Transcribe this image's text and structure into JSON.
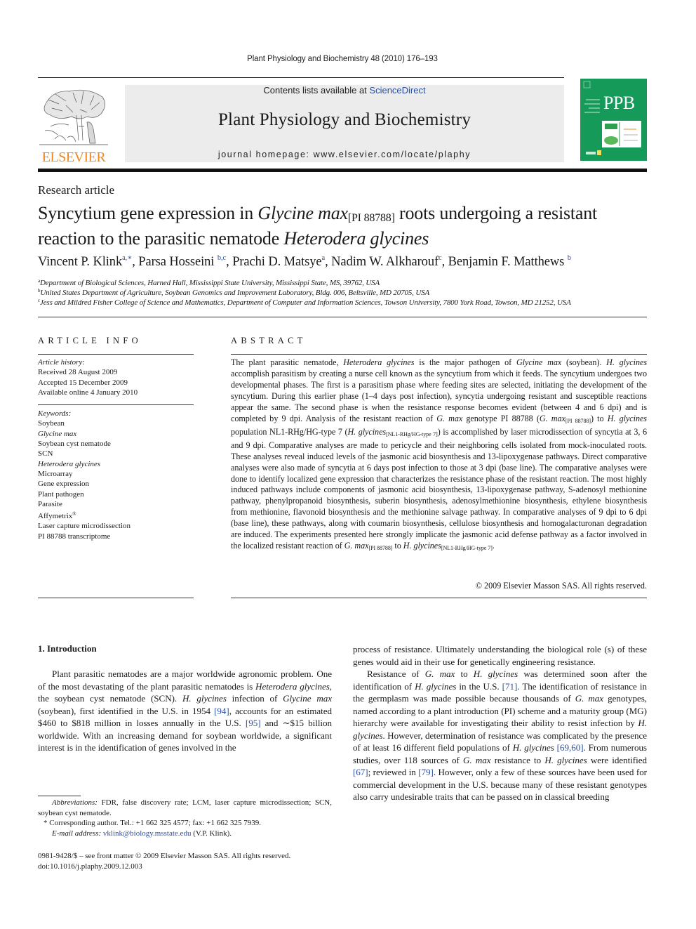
{
  "running_head": "Plant Physiology and Biochemistry 48 (2010) 176–193",
  "header": {
    "publisher_name": "ELSEVIER",
    "contents_prefix": "Contents lists available at ",
    "contents_link": "ScienceDirect",
    "journal_title": "Plant Physiology and Biochemistry",
    "homepage": "journal homepage: www.elsevier.com/locate/plaphy",
    "cover_abbrev": "PPB",
    "colors": {
      "publisher_orange": "#f0871e",
      "cover_green": "#159a5a",
      "link_blue": "#2a4fa0",
      "header_gray": "#ececec"
    }
  },
  "article": {
    "type": "Research article",
    "title": {
      "p1": "Syncytium gene expression in ",
      "p2_it": "Glycine max",
      "p3_sub": "[PI 88788]",
      "p4": " roots undergoing a resistant reaction to the parasitic nematode ",
      "p5_it": "Heterodera glycines"
    },
    "authors": [
      {
        "name": "Vincent P. Klink",
        "sup": "a,∗"
      },
      {
        "name": "Parsa Hosseini",
        "sup": "b,c"
      },
      {
        "name": "Prachi D. Matsye",
        "sup": "a"
      },
      {
        "name": "Nadim W. Alkharouf",
        "sup": "c"
      },
      {
        "name": "Benjamin F. Matthews",
        "sup": "b"
      }
    ],
    "affiliations": [
      {
        "mark": "a",
        "text": "Department of Biological Sciences, Harned Hall, Mississippi State University, Mississippi State, MS, 39762, USA"
      },
      {
        "mark": "b",
        "text": "United States Department of Agriculture, Soybean Genomics and Improvement Laboratory, Bldg. 006, Beltsville, MD 20705, USA"
      },
      {
        "mark": "c",
        "text": "Jess and Mildred Fisher College of Science and Mathematics, Department of Computer and Information Sciences, Towson University, 7800 York Road, Towson, MD 21252, USA"
      }
    ]
  },
  "article_info": {
    "heading": "ARTICLE INFO",
    "history_label": "Article history:",
    "received": "Received 28 August 2009",
    "accepted": "Accepted 15 December 2009",
    "online": "Available online 4 January 2010",
    "keywords_label": "Keywords:",
    "keywords": [
      "Soybean",
      "Glycine max",
      "Soybean cyst nematode",
      "SCN",
      "Heterodera glycines",
      "Microarray",
      "Gene expression",
      "Plant pathogen",
      "Parasite",
      "Affymetrix",
      "Laser capture microdissection",
      "PI 88788 transcriptome"
    ],
    "keyword_trademark": "®"
  },
  "abstract": {
    "heading": "ABSTRACT",
    "t01": "The plant parasitic nematode, ",
    "t02": "Heterodera glycines",
    "t03": " is the major pathogen of ",
    "t04": "Glycine max",
    "t05": " (soybean). ",
    "t06": "H. glycines",
    "t07": " accomplish parasitism by creating a nurse cell known as the syncytium from which it feeds. The syncytium undergoes two developmental phases. The first is a parasitism phase where feeding sites are selected, initiating the development of the syncytium. During this earlier phase (1–4 days post infection), syncytia undergoing resistant and susceptible reactions appear the same. The second phase is when the resistance response becomes evident (between 4 and 6 dpi) and is completed by 9 dpi. Analysis of the resistant reaction of ",
    "t08": "G. max",
    "t09": " genotype PI 88788 (",
    "t10": "G. max",
    "t11": "[PI 88788]",
    "t12": ") to ",
    "t13": "H. glycines",
    "t14": " population NL1-RHg/HG-type 7 (",
    "t15": "H. glycines",
    "t16": "[NL1-RHg/HG-type 7]",
    "t17": ") is accomplished by laser microdissection of syncytia at 3, 6 and 9 dpi. Comparative analyses are made to pericycle and their neighboring cells isolated from mock-inoculated roots. These analyses reveal induced levels of the jasmonic acid biosynthesis and 13-lipoxygenase pathways. Direct comparative analyses were also made of syncytia at 6 days post infection to those at 3 dpi (base line). The comparative analyses were done to identify localized gene expression that characterizes the resistance phase of the resistant reaction. The most highly induced pathways include components of jasmonic acid biosynthesis, 13-lipoxygenase pathway, S-adenosyl methionine pathway, phenylpropanoid biosynthesis, suberin biosynthesis, adenosylmethionine biosynthesis, ethylene biosynthesis from methionine, flavonoid biosynthesis and the methionine salvage pathway. In comparative analyses of 9 dpi to 6 dpi (base line), these pathways, along with coumarin biosynthesis, cellulose biosynthesis and homogalacturonan degradation are induced. The experiments presented here strongly implicate the jasmonic acid defense pathway as a factor involved in the localized resistant reaction of ",
    "t18": "G. max",
    "t19": "[PI 88788]",
    "t20": " to ",
    "t21": "H. glycines",
    "t22": "[NL1-RHg/HG-type 7]",
    "t23": ".",
    "copyright": "© 2009 Elsevier Masson SAS. All rights reserved."
  },
  "introduction": {
    "heading": "1.  Introduction",
    "c1": {
      "a": "Plant parasitic nematodes are a major worldwide agronomic problem. One of the most devastating of the plant parasitic nematodes is ",
      "b_it": "Heterodera glycines",
      "c": ", the soybean cyst nematode (SCN). ",
      "d_it": "H. glycines",
      "e": " infection of ",
      "f_it": "Glycine max",
      "g": " (soybean), first identified in the U.S. in 1954 ",
      "ref1": "[94]",
      "h": ", accounts for an estimated $460 to $818 million in losses annually in the U.S. ",
      "ref2": "[95]",
      "i": " and ∼$15 billion worldwide. With an increasing demand for soybean worldwide, a significant interest is in the identification of genes involved in the"
    },
    "c2": {
      "p1": "process of resistance. Ultimately understanding the biological role (s) of these genes would aid in their use for genetically engineering resistance.",
      "a": "Resistance of ",
      "b_it": "G. max",
      "c": " to ",
      "d_it": "H. glycines",
      "e": " was determined soon after the identification of ",
      "f_it": "H. glycines",
      "g": " in the U.S. ",
      "ref1": "[71]",
      "h": ". The identification of resistance in the germplasm was made possible because thousands of ",
      "i_it": "G. max",
      "j": " genotypes, named according to a plant introduction (PI) scheme and a maturity group (MG) hierarchy were available for investigating their ability to resist infection by ",
      "k_it": "H. glycines",
      "l": ". However, determination of resistance was complicated by the presence of at least 16 different field populations of ",
      "m_it": "H. glycines",
      "n": " ",
      "ref2": "[69,60]",
      "o": ". From numerous studies, over 118 sources of ",
      "p_it": "G. max",
      "q": " resistance to ",
      "r_it": "H. glycines",
      "s": " were identified ",
      "ref3": "[67]",
      "t": "; reviewed in ",
      "ref4": "[79]",
      "u": ". However, only a few of these sources have been used for commercial development in the U.S. because many of these resistant genotypes also carry undesirable traits that can be passed on in classical breeding"
    }
  },
  "footnotes": {
    "abbr_label": "Abbreviations:",
    "abbr_text": " FDR, false discovery rate; LCM, laser capture microdissection; SCN, soybean cyst nematode.",
    "corr_mark": "*",
    "corr_text": " Corresponding author. Tel.: +1 662 325 4577; fax: +1 662 325 7939.",
    "email_label": "E-mail address:",
    "email": "vklink@biology.msstate.edu",
    "email_suffix": " (V.P. Klink)."
  },
  "front_matter": {
    "issn_line": "0981-9428/$ – see front matter © 2009 Elsevier Masson SAS. All rights reserved.",
    "doi": "doi:10.1016/j.plaphy.2009.12.003"
  }
}
